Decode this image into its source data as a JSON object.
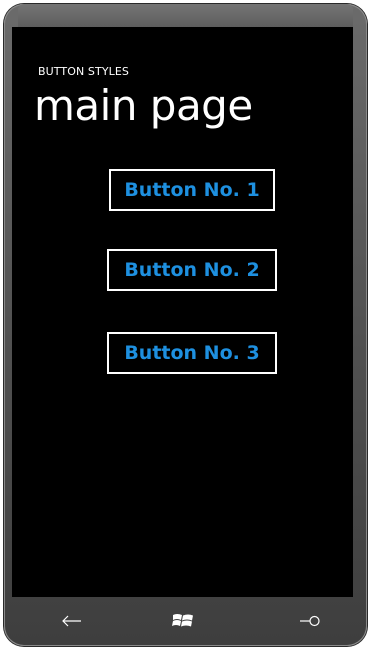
{
  "app": {
    "title": "BUTTON STYLES",
    "page_title": "main page"
  },
  "buttons": [
    {
      "label": "Button No. 1"
    },
    {
      "label": "Button No. 2"
    },
    {
      "label": "Button No. 3"
    }
  ],
  "colors": {
    "background": "#000000",
    "button_text": "#1e90e0",
    "button_border": "#ffffff",
    "text": "#ffffff"
  },
  "hardware_buttons": [
    {
      "icon": "back-arrow-icon"
    },
    {
      "icon": "windows-start-icon"
    },
    {
      "icon": "search-icon"
    }
  ]
}
